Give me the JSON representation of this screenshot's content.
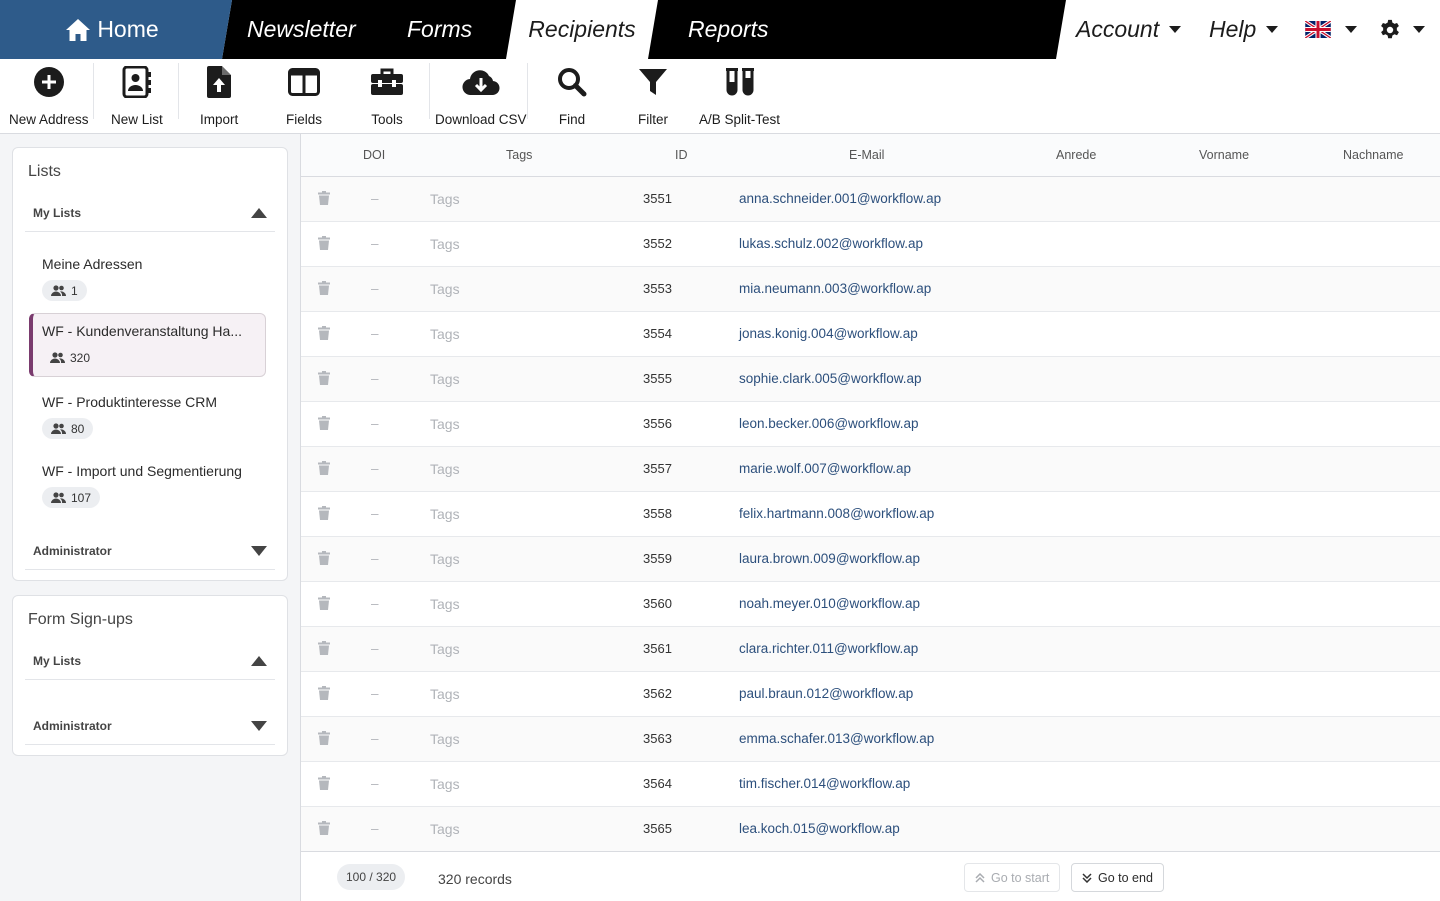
{
  "nav": {
    "home": "Home",
    "items": [
      "Newsletter",
      "Forms",
      "Recipients",
      "Reports"
    ],
    "active": "Recipients",
    "account": "Account",
    "help": "Help"
  },
  "toolbar": {
    "new_address": "New Address",
    "new_list": "New List",
    "import": "Import",
    "fields": "Fields",
    "tools": "Tools",
    "download_csv": "Download CSV",
    "find": "Find",
    "filter": "Filter",
    "ab_split": "A/B Split-Test"
  },
  "lists_panel": {
    "title": "Lists",
    "my_lists": "My Lists",
    "administrator": "Administrator",
    "items": [
      {
        "name": "Meine Adressen",
        "count": "1"
      },
      {
        "name": "WF - Kundenveranstaltung Ha...",
        "count": "320"
      },
      {
        "name": "WF - Produktinteresse CRM",
        "count": "80"
      },
      {
        "name": "WF - Import und Segmentierung",
        "count": "107"
      }
    ]
  },
  "forms_panel": {
    "title": "Form Sign-ups",
    "my_lists": "My Lists",
    "administrator": "Administrator"
  },
  "table": {
    "headers": {
      "doi": "DOI",
      "tags": "Tags",
      "id": "ID",
      "email": "E-Mail",
      "anrede": "Anrede",
      "vorname": "Vorname",
      "nachname": "Nachname"
    },
    "rows": [
      {
        "doi": "–",
        "tags": "Tags",
        "id": "3551",
        "email": "anna.schneider.001@workflow.ap"
      },
      {
        "doi": "–",
        "tags": "Tags",
        "id": "3552",
        "email": "lukas.schulz.002@workflow.ap"
      },
      {
        "doi": "–",
        "tags": "Tags",
        "id": "3553",
        "email": "mia.neumann.003@workflow.ap"
      },
      {
        "doi": "–",
        "tags": "Tags",
        "id": "3554",
        "email": "jonas.konig.004@workflow.ap"
      },
      {
        "doi": "–",
        "tags": "Tags",
        "id": "3555",
        "email": "sophie.clark.005@workflow.ap"
      },
      {
        "doi": "–",
        "tags": "Tags",
        "id": "3556",
        "email": "leon.becker.006@workflow.ap"
      },
      {
        "doi": "–",
        "tags": "Tags",
        "id": "3557",
        "email": "marie.wolf.007@workflow.ap"
      },
      {
        "doi": "–",
        "tags": "Tags",
        "id": "3558",
        "email": "felix.hartmann.008@workflow.ap"
      },
      {
        "doi": "–",
        "tags": "Tags",
        "id": "3559",
        "email": "laura.brown.009@workflow.ap"
      },
      {
        "doi": "–",
        "tags": "Tags",
        "id": "3560",
        "email": "noah.meyer.010@workflow.ap"
      },
      {
        "doi": "–",
        "tags": "Tags",
        "id": "3561",
        "email": "clara.richter.011@workflow.ap"
      },
      {
        "doi": "–",
        "tags": "Tags",
        "id": "3562",
        "email": "paul.braun.012@workflow.ap"
      },
      {
        "doi": "–",
        "tags": "Tags",
        "id": "3563",
        "email": "emma.schafer.013@workflow.ap"
      },
      {
        "doi": "–",
        "tags": "Tags",
        "id": "3564",
        "email": "tim.fischer.014@workflow.ap"
      },
      {
        "doi": "–",
        "tags": "Tags",
        "id": "3565",
        "email": "lea.koch.015@workflow.ap"
      }
    ]
  },
  "footer": {
    "page_count": "100 / 320",
    "records": "320 records",
    "go_to_start": "Go to start",
    "go_to_end": "Go to end"
  },
  "colors": {
    "home_bg": "#2e5b8a",
    "nav_bg": "#000000",
    "selected_accent": "#7a3b6e",
    "email_link": "#2c4f7c"
  }
}
